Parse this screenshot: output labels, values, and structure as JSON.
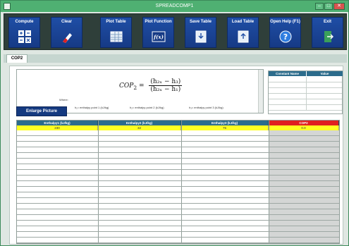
{
  "window": {
    "title": "SPREADCOMP1",
    "min_label": "–",
    "max_label": "□",
    "close_label": "✕"
  },
  "toolbar": {
    "buttons": [
      {
        "label": "Compute",
        "icon": "calculator-icon"
      },
      {
        "label": "Clear",
        "icon": "eraser-icon"
      },
      {
        "label": "Plot Table",
        "icon": "plot-table-icon"
      },
      {
        "label": "Plot Function",
        "icon": "plot-function-icon"
      },
      {
        "label": "Save Table",
        "icon": "save-table-icon"
      },
      {
        "label": "Load Table",
        "icon": "load-table-icon"
      },
      {
        "label": "Open Help (F1)",
        "icon": "help-icon"
      },
      {
        "label": "Exit",
        "icon": "exit-door-icon"
      }
    ]
  },
  "tabs": {
    "active": "COP2"
  },
  "formula": {
    "lhs": "COP",
    "lhs_sub": "2",
    "numerator": "(h₂ₓ − h₃)",
    "denominator": "(h₂ₓ − h₁)",
    "where": "Where:",
    "legend": [
      "h₁= enthalpy point 1 (kJ/kg)",
      "h₂= enthalpy point 2 (kJ/kg)",
      "h₃= enthalpy point 3 (kJ/kg)"
    ]
  },
  "enlarge_button": "Enlarge Picture",
  "constants_table": {
    "headers": [
      "Constant Name",
      "Value"
    ]
  },
  "grid": {
    "headers": [
      "Enthalpy1 (kJ/kg)",
      "Enthalpy2 (kJ/kg)",
      "Enthalpy3 (kJ/kg)",
      "COP2"
    ],
    "values": [
      "230",
      "32",
      "75",
      "0.0"
    ]
  },
  "colors": {
    "title_bar": "#4fb072",
    "toolbar_button": "#1f4ea6",
    "column_header": "#2c6c8c",
    "result_header": "#e02020",
    "input_highlight": "#ffff22"
  }
}
